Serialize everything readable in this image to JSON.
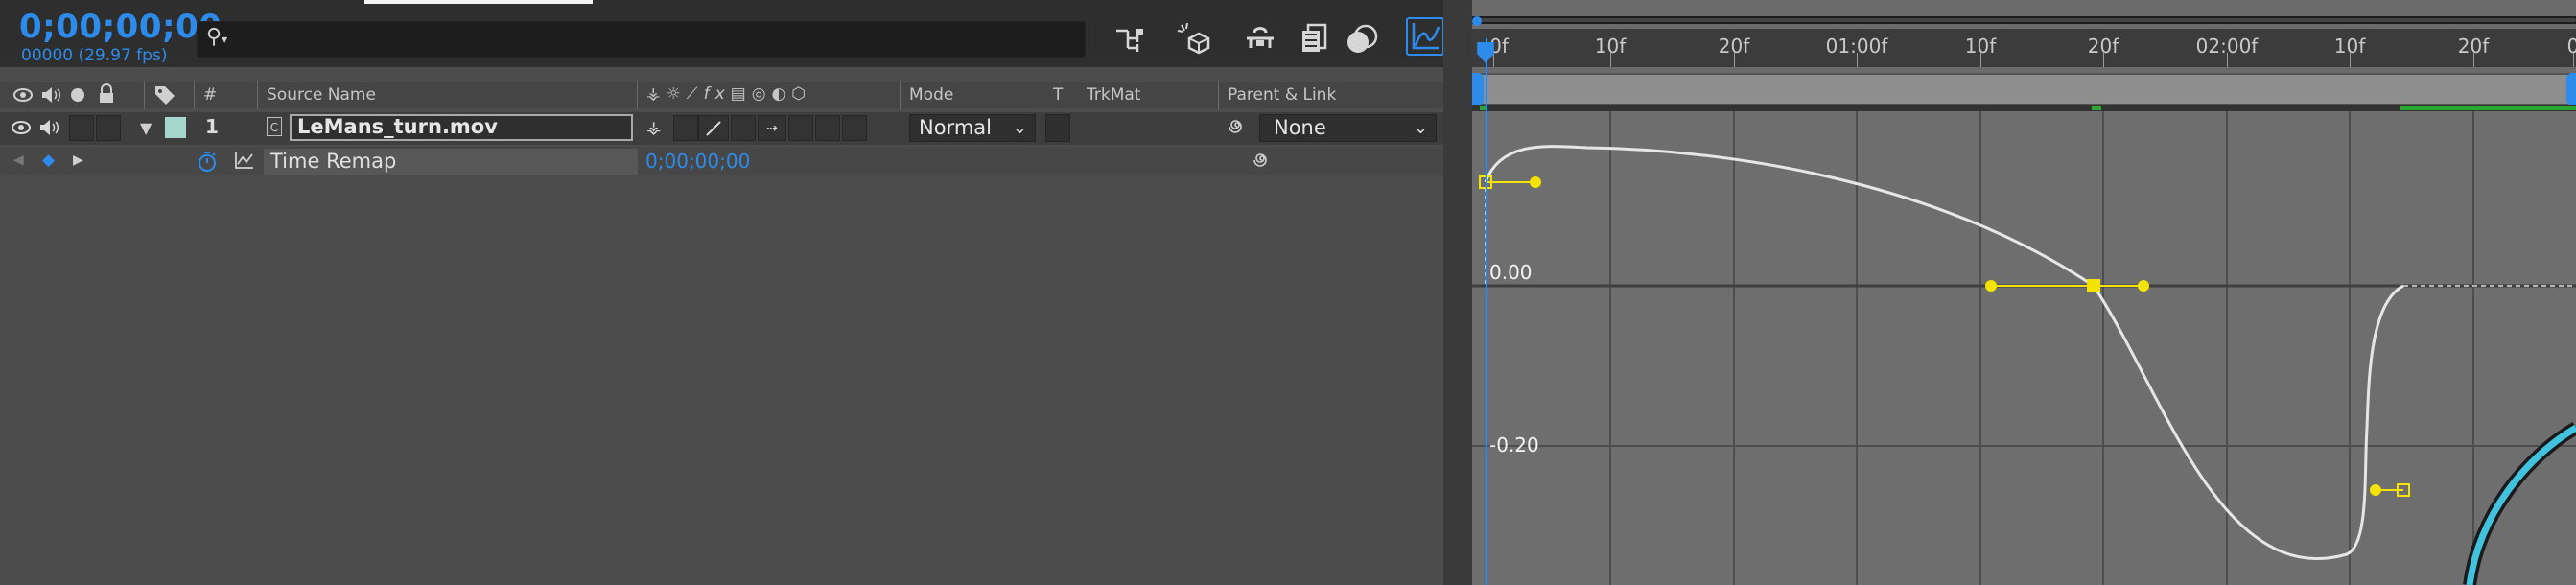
{
  "header": {
    "timecode": "0;00;00;00",
    "frame_rate": "00000 (29.97 fps)"
  },
  "search": {
    "placeholder": ""
  },
  "toolbar_icons": [
    "composition-mini-flowchart-icon",
    "draft-3d-icon",
    "hide-shy-layers-icon",
    "frame-blending-icon",
    "motion-blur-icon",
    "graph-editor-icon"
  ],
  "columns": {
    "number": "#",
    "source_name": "Source Name",
    "mode": "Mode",
    "t": "T",
    "trkmat": "TrkMat",
    "parent_link": "Parent & Link"
  },
  "layer": {
    "number": "1",
    "name": "LeMans_turn.mov",
    "mode": "Normal",
    "parent": "None",
    "label_color": "#a6d7cc"
  },
  "property": {
    "name": "Time Remap",
    "value": "0;00;00;00"
  },
  "timeline": {
    "ticks": [
      "0f",
      "10f",
      "20f",
      "01:00f",
      "10f",
      "20f",
      "02:00f",
      "10f",
      "20f",
      "0"
    ]
  },
  "graph": {
    "value_labels": [
      "0.00",
      "-0.20"
    ]
  },
  "colors": {
    "accent": "#2d8ceb",
    "keyframe": "#f4e300",
    "curve": "#e6e6e6"
  }
}
